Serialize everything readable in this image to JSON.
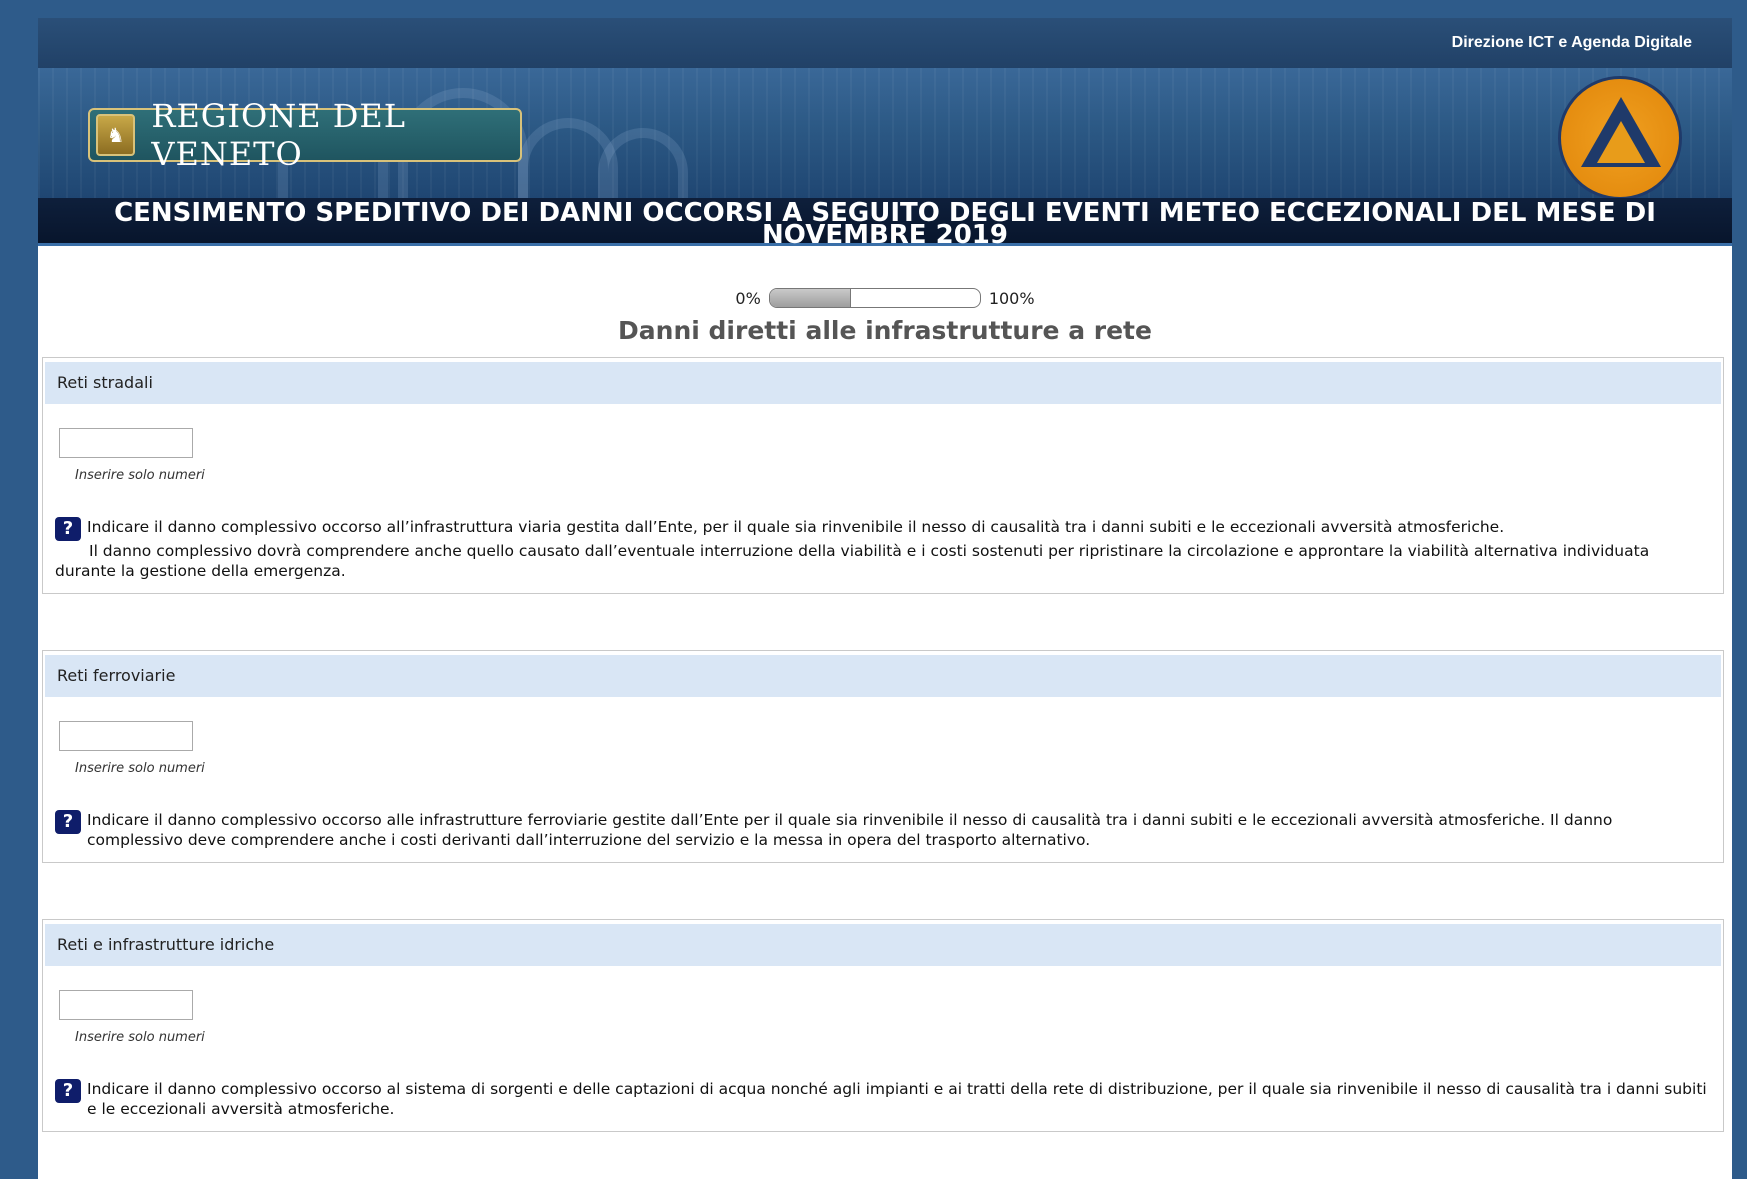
{
  "header": {
    "department": "Direzione ICT e Agenda Digitale",
    "logo_text": "REGIONE DEL VENETO",
    "title_line1": "CENSIMENTO SPEDITIVO DEI DANNI OCCORSI A SEGUITO DEGLI EVENTI METEO ECCEZIONALI DEL MESE DI",
    "title_line2": "NOVEMBRE 2019"
  },
  "progress": {
    "start_label": "0%",
    "end_label": "100%",
    "fraction": 0.38
  },
  "page_heading": "Danni diretti alle infrastrutture a rete",
  "sections": [
    {
      "label": "Reti stradali",
      "input_value": "",
      "hint": "Inserire solo numeri",
      "help_line1": "Indicare il danno complessivo occorso all’infrastruttura viaria gestita dall’Ente, per il quale sia rinvenibile il nesso di causalità tra i danni subiti e le eccezionali avversità atmosferiche.",
      "help_line2": "Il danno complessivo dovrà comprendere anche quello causato dall’eventuale interruzione della viabilità e i costi sostenuti per ripristinare la circolazione e approntare la viabilità alternativa individuata durante la gestione della emergenza."
    },
    {
      "label": "Reti ferroviarie",
      "input_value": "",
      "hint": "Inserire solo numeri",
      "help_line1": "Indicare il danno complessivo occorso alle infrastrutture ferroviarie gestite dall’Ente per il quale sia rinvenibile il nesso di causalità tra i danni subiti e le eccezionali avversità atmosferiche. Il danno complessivo deve comprendere anche i costi derivanti dall’interruzione del servizio e la messa in opera del trasporto alternativo."
    },
    {
      "label": "Reti e infrastrutture idriche",
      "input_value": "",
      "hint": "Inserire solo numeri",
      "help_line1": "Indicare il danno complessivo occorso al sistema di sorgenti e delle captazioni di acqua nonché agli impianti e ai tratti della rete di distribuzione, per il quale sia rinvenibile il nesso di causalità tra i danni subiti e le eccezionali avversità atmosferiche."
    }
  ],
  "icons": {
    "help": "question-mark-icon",
    "crest": "region-crest-icon",
    "civil_protection": "civil-protection-logo"
  },
  "colors": {
    "page_bg": "#2e5b8a",
    "title_bar": "#0e1f3b",
    "section_header": "#d9e6f5",
    "help_icon": "#0f1d6a"
  }
}
